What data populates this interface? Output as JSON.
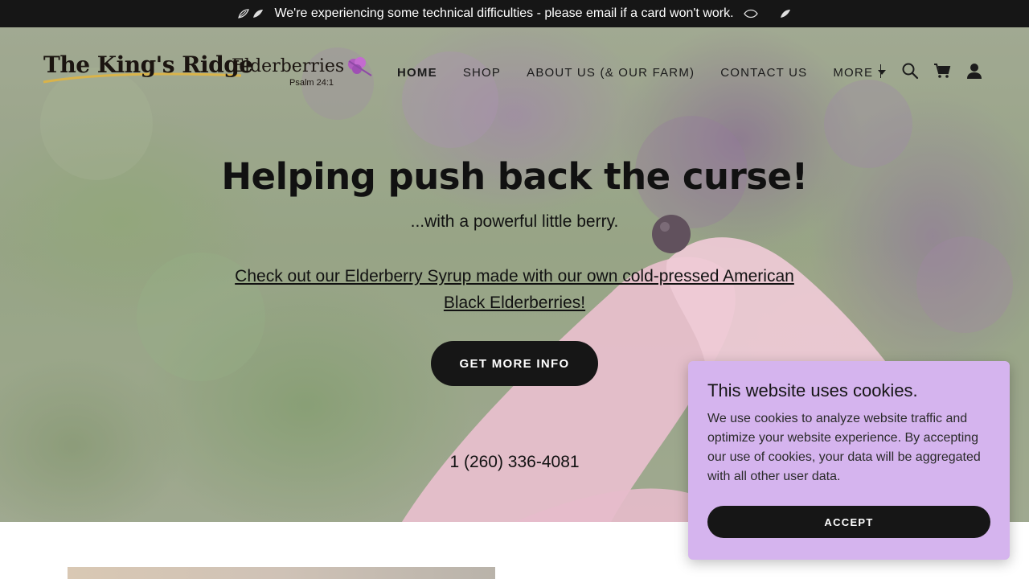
{
  "announcement": {
    "text": "We're experiencing some technical difficulties - please email if a card won't work."
  },
  "logo": {
    "main": "The King's Ridge",
    "sub": "Elderberries",
    "verse": "Psalm 24:1"
  },
  "nav": {
    "items": [
      "HOME",
      "SHOP",
      "ABOUT US (& OUR FARM)",
      "CONTACT US"
    ],
    "more_label": "MORE",
    "active": "HOME"
  },
  "hero": {
    "title": "Helping push back the curse!",
    "subtitle": "...with a powerful little berry.",
    "link_text": "Check out our Elderberry Syrup made with our own cold-pressed American Black Elderberries!",
    "cta_label": "GET MORE INFO",
    "phone": "1 (260) 336-4081"
  },
  "cookie": {
    "title": "This website uses cookies.",
    "body": "We use cookies to analyze website traffic and optimize your website experience. By accepting our use of cookies, your data will be aggregated with all other user data.",
    "accept_label": "ACCEPT",
    "background": "#d5b4ee"
  },
  "colors": {
    "announcement_bg": "#161616",
    "button_bg": "#161616",
    "text": "#111111"
  },
  "icons": [
    "leaf-icon",
    "search-icon",
    "cart-icon",
    "account-icon",
    "caret-down-icon"
  ]
}
